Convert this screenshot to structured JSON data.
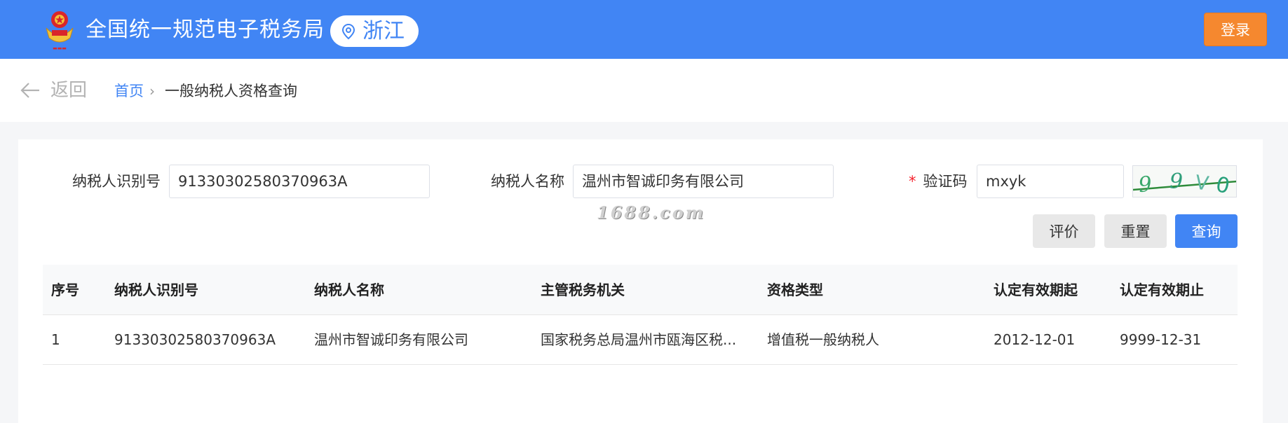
{
  "header": {
    "site_title": "全国统一规范电子税务局",
    "region": "浙江",
    "login_label": "登录"
  },
  "nav": {
    "back_label": "返回",
    "breadcrumb_home": "首页",
    "breadcrumb_separator": "›",
    "breadcrumb_current": "一般纳税人资格查询"
  },
  "form": {
    "taxpayer_id_label": "纳税人识别号",
    "taxpayer_id_value": "91330302580370963A",
    "taxpayer_name_label": "纳税人名称",
    "taxpayer_name_value": "温州市智诚印务有限公司",
    "captcha_required_mark": "*",
    "captcha_label": "验证码",
    "captcha_value": "mxyk",
    "captcha_image_text": "99V0"
  },
  "watermark": "1688.com",
  "buttons": {
    "evaluate": "评价",
    "reset": "重置",
    "query": "查询"
  },
  "table": {
    "columns": [
      "序号",
      "纳税人识别号",
      "纳税人名称",
      "主管税务机关",
      "资格类型",
      "认定有效期起",
      "认定有效期止"
    ],
    "rows": [
      [
        "1",
        "91330302580370963A",
        "温州市智诚印务有限公司",
        "国家税务总局温州市瓯海区税...",
        "增值税一般纳税人",
        "2012-12-01",
        "9999-12-31"
      ]
    ]
  },
  "colors": {
    "header_blue": "#4185f4",
    "login_orange": "#f5882f",
    "required_red": "#f5222d"
  }
}
